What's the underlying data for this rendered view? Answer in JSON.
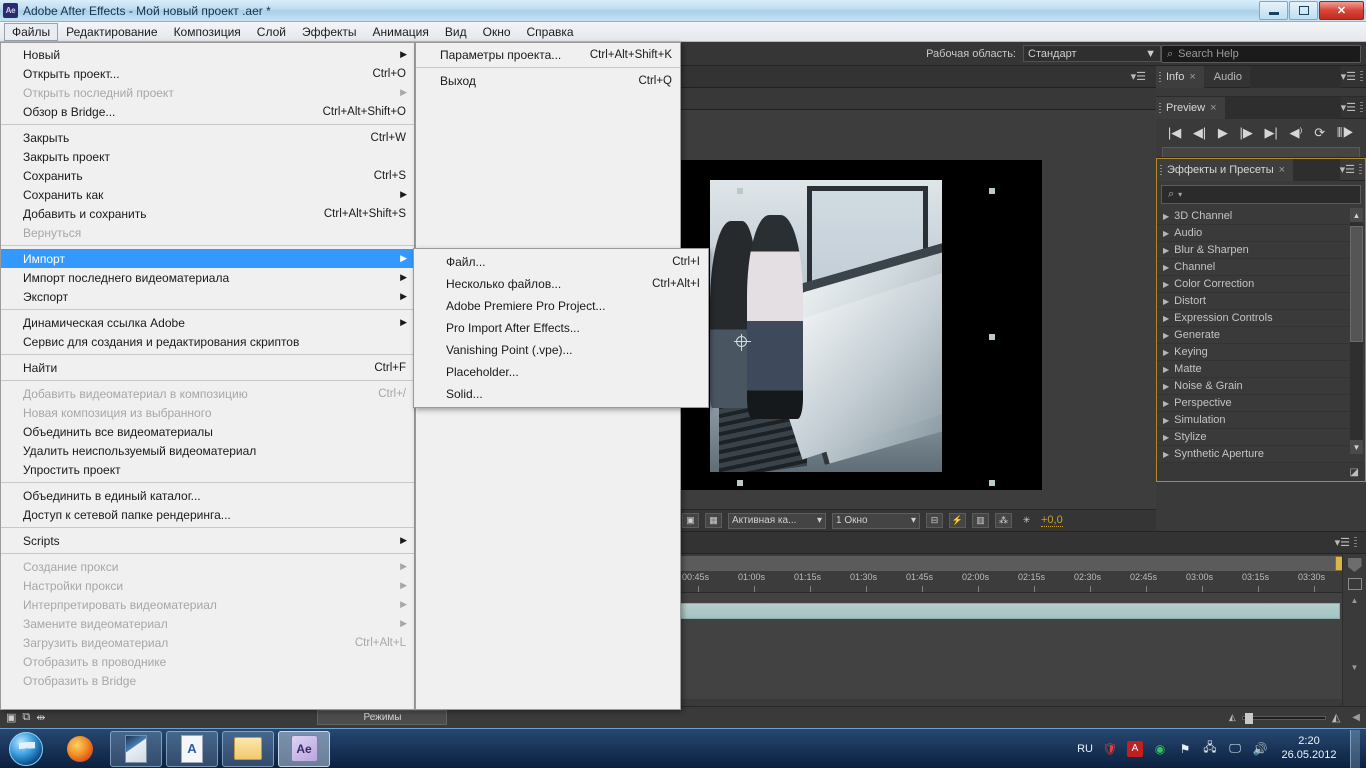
{
  "window": {
    "app_icon": "Ae",
    "title": "Adobe After Effects -  Мой новый проект .aer *",
    "minimize": "–",
    "maximize": "❐",
    "close": "✕"
  },
  "menubar": {
    "items": [
      {
        "label": "Файлы",
        "active": true
      },
      {
        "label": "Редактирование",
        "active": false
      },
      {
        "label": "Композиция",
        "active": false
      },
      {
        "label": "Слой",
        "active": false
      },
      {
        "label": "Эффекты",
        "active": false
      },
      {
        "label": "Анимация",
        "active": false
      },
      {
        "label": "Вид",
        "active": false
      },
      {
        "label": "Окно",
        "active": false
      },
      {
        "label": "Справка",
        "active": false
      }
    ]
  },
  "toolbar": {
    "workspace_label": "Рабочая область:",
    "workspace_value": "Стандарт",
    "search_help_placeholder": "Search Help",
    "search_icon": "search-icon"
  },
  "file_menu": {
    "groups": [
      [
        {
          "label": "Новый",
          "accel": "",
          "submenu": true,
          "disabled": false,
          "highlighted": false
        },
        {
          "label": "Открыть проект...",
          "accel": "Ctrl+O",
          "submenu": false,
          "disabled": false,
          "highlighted": false
        },
        {
          "label": "Открыть последний проект",
          "accel": "",
          "submenu": true,
          "disabled": true,
          "highlighted": false
        },
        {
          "label": "Обзор в Bridge...",
          "accel": "Ctrl+Alt+Shift+O",
          "submenu": false,
          "disabled": false,
          "highlighted": false
        }
      ],
      [
        {
          "label": "Закрыть",
          "accel": "Ctrl+W",
          "submenu": false,
          "disabled": false,
          "highlighted": false
        },
        {
          "label": "Закрыть проект",
          "accel": "",
          "submenu": false,
          "disabled": false,
          "highlighted": false
        },
        {
          "label": "Сохранить",
          "accel": "Ctrl+S",
          "submenu": false,
          "disabled": false,
          "highlighted": false
        },
        {
          "label": "Сохранить как",
          "accel": "",
          "submenu": true,
          "disabled": false,
          "highlighted": false
        },
        {
          "label": "Добавить и сохранить",
          "accel": "Ctrl+Alt+Shift+S",
          "submenu": false,
          "disabled": false,
          "highlighted": false
        },
        {
          "label": "Вернуться",
          "accel": "",
          "submenu": false,
          "disabled": true,
          "highlighted": false
        }
      ],
      [
        {
          "label": "Импорт",
          "accel": "",
          "submenu": true,
          "disabled": false,
          "highlighted": true
        },
        {
          "label": "Импорт последнего видеоматериала",
          "accel": "",
          "submenu": true,
          "disabled": false,
          "highlighted": false
        },
        {
          "label": "Экспорт",
          "accel": "",
          "submenu": true,
          "disabled": false,
          "highlighted": false
        }
      ],
      [
        {
          "label": "Динамическая ссылка Adobe",
          "accel": "",
          "submenu": true,
          "disabled": false,
          "highlighted": false
        },
        {
          "label": "Сервис для создания и редактирования скриптов",
          "accel": "",
          "submenu": false,
          "disabled": false,
          "highlighted": false
        }
      ],
      [
        {
          "label": "Найти",
          "accel": "Ctrl+F",
          "submenu": false,
          "disabled": false,
          "highlighted": false
        }
      ],
      [
        {
          "label": "Добавить видеоматериал в композицию",
          "accel": "Ctrl+/",
          "submenu": false,
          "disabled": true,
          "highlighted": false
        },
        {
          "label": "Новая композиция из выбранного",
          "accel": "",
          "submenu": false,
          "disabled": true,
          "highlighted": false
        },
        {
          "label": "Объединить все видеоматериалы",
          "accel": "",
          "submenu": false,
          "disabled": false,
          "highlighted": false
        },
        {
          "label": "Удалить неиспользуемый видеоматериал",
          "accel": "",
          "submenu": false,
          "disabled": false,
          "highlighted": false
        },
        {
          "label": "Упростить проект",
          "accel": "",
          "submenu": false,
          "disabled": false,
          "highlighted": false
        }
      ],
      [
        {
          "label": "Объединить в единый каталог...",
          "accel": "",
          "submenu": false,
          "disabled": false,
          "highlighted": false
        },
        {
          "label": "Доступ к сетевой папке рендеринга...",
          "accel": "",
          "submenu": false,
          "disabled": false,
          "highlighted": false
        }
      ],
      [
        {
          "label": "Scripts",
          "accel": "",
          "submenu": true,
          "disabled": false,
          "highlighted": false
        }
      ],
      [
        {
          "label": "Создание прокси",
          "accel": "",
          "submenu": true,
          "disabled": true,
          "highlighted": false
        },
        {
          "label": "Настройки прокси",
          "accel": "",
          "submenu": true,
          "disabled": true,
          "highlighted": false
        },
        {
          "label": "Интерпретировать видеоматериал",
          "accel": "",
          "submenu": true,
          "disabled": true,
          "highlighted": false
        },
        {
          "label": "Замените видеоматериал",
          "accel": "",
          "submenu": true,
          "disabled": true,
          "highlighted": false
        },
        {
          "label": "Загрузить видеоматериал",
          "accel": "Ctrl+Alt+L",
          "submenu": false,
          "disabled": true,
          "highlighted": false
        },
        {
          "label": "Отобразить в проводнике",
          "accel": "",
          "submenu": false,
          "disabled": true,
          "highlighted": false
        },
        {
          "label": "Отобразить в Bridge",
          "accel": "",
          "submenu": false,
          "disabled": true,
          "highlighted": false
        }
      ]
    ]
  },
  "exit_submenu": {
    "items": [
      {
        "label": "Параметры проекта...",
        "accel": "Ctrl+Alt+Shift+K",
        "sep_after": true
      },
      {
        "label": "Выход",
        "accel": "Ctrl+Q",
        "sep_after": false
      }
    ]
  },
  "import_submenu": {
    "items": [
      {
        "label": "Файл...",
        "accel": "Ctrl+I"
      },
      {
        "label": "Несколько файлов...",
        "accel": "Ctrl+Alt+I"
      },
      {
        "label": "Adobe Premiere Pro Project...",
        "accel": ""
      },
      {
        "label": "Pro Import After Effects...",
        "accel": ""
      },
      {
        "label": "Vanishing Point (.vpe)...",
        "accel": ""
      },
      {
        "label": "Placeholder...",
        "accel": ""
      },
      {
        "label": "Solid...",
        "accel": ""
      }
    ]
  },
  "right_dock": {
    "info_tab": "Info",
    "audio_tab": "Audio",
    "preview_tab": "Preview",
    "preview_buttons": [
      "first-frame-icon",
      "previous-frame-icon",
      "play-icon",
      "next-frame-icon",
      "last-frame-icon",
      "audio-icon",
      "loop-icon",
      "ram-preview-icon"
    ],
    "effects_tab": "Эффекты и Пресеты",
    "effects_search_placeholder": "",
    "effects_categories": [
      "3D Channel",
      "Audio",
      "Blur & Sharpen",
      "Channel",
      "Color Correction",
      "Distort",
      "Expression Controls",
      "Generate",
      "Keying",
      "Matte",
      "Noise & Grain",
      "Perspective",
      "Simulation",
      "Stylize",
      "Synthetic Aperture"
    ]
  },
  "comp_footer": {
    "toggle_transparency_icon": "transparency-grid-icon",
    "alpha_icon": "alpha-channel-icon",
    "camera_value": "Активная ка...",
    "views_value": "1 Окно",
    "region_icon": "region-of-interest-icon",
    "fast_preview_icon": "fast-preview-icon",
    "timeline_icon": "timeline-icon",
    "flowchart_icon": "flowchart-icon",
    "exposure_icon": "exposure-icon",
    "exposure_value": "+0,0"
  },
  "timeline": {
    "ruler_ticks": [
      "00:45s",
      "01:00s",
      "01:15s",
      "01:30s",
      "01:45s",
      "02:00s",
      "02:15s",
      "02:30s",
      "02:45s",
      "03:00s",
      "03:15s",
      "03:30s"
    ]
  },
  "ae_status": {
    "icons": [
      "snapshot-icon",
      "layer-snapshot-icon",
      "transform-icon"
    ],
    "modes_label": "Режимы",
    "zoom_out_icon": "zoom-out-icon",
    "zoom_in_icon": "zoom-in-icon"
  },
  "taskbar": {
    "start_label": "start-orb-icon",
    "items": [
      {
        "name": "firefox-icon",
        "glyph": "🦊",
        "state": "open"
      },
      {
        "name": "paint-icon",
        "glyph": "🖌",
        "state": "open"
      },
      {
        "name": "wordpad-icon",
        "glyph": "🅰",
        "state": "open"
      },
      {
        "name": "explorer-folder-icon",
        "glyph": "🗂",
        "state": "open"
      },
      {
        "name": "after-effects-icon",
        "glyph": "Ae",
        "state": "active"
      }
    ],
    "language": "RU",
    "tray_icons": [
      "kaspersky-icon",
      "adobe-updater-icon",
      "utorrent-icon",
      "action-flag-icon",
      "network-warning-icon",
      "display-icon",
      "volume-icon"
    ],
    "time": "2:20",
    "date": "26.05.2012"
  }
}
